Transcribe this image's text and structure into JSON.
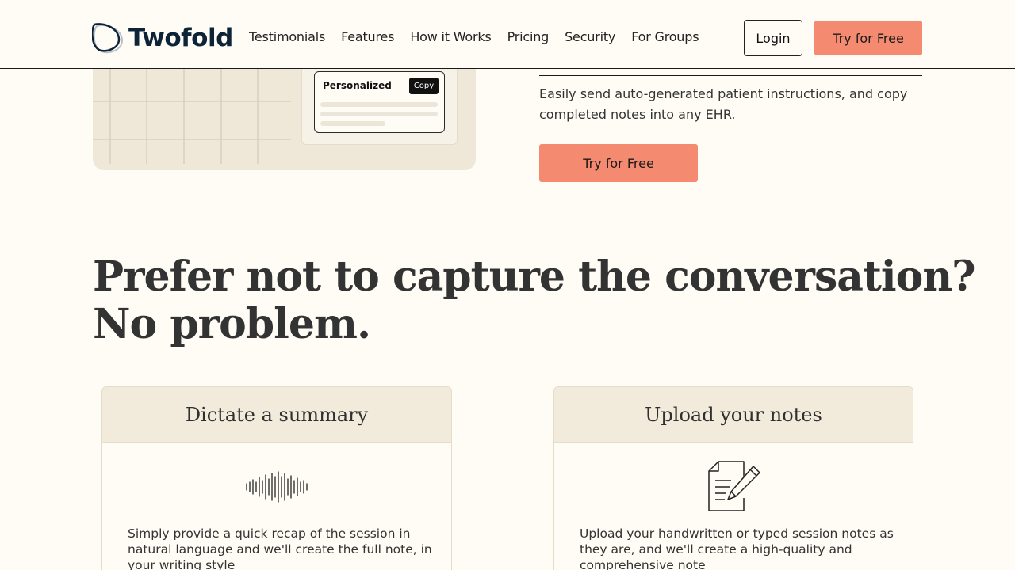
{
  "header": {
    "brand": "Twofold",
    "nav": [
      "Testimonials",
      "Features",
      "How it Works",
      "Pricing",
      "Security",
      "For Groups"
    ],
    "login_label": "Login",
    "try_label": "Try for Free"
  },
  "illustration": {
    "card_title": "Personalized",
    "copy_label": "Copy"
  },
  "feature": {
    "description": "Easily send auto-generated patient instructions, and copy completed notes into any EHR.",
    "cta_label": "Try for Free"
  },
  "headline": {
    "line1": "Prefer not to capture the conversation?",
    "line2": "No problem."
  },
  "options": [
    {
      "title": "Dictate a summary",
      "icon": "waveform-icon",
      "body": "Simply provide a quick recap of the session in natural language and we'll create the full note, in your writing style"
    },
    {
      "title": "Upload your notes",
      "icon": "document-pencil-icon",
      "body": "Upload your handwritten or typed session notes as they are, and we'll create a high-quality and comprehensive note"
    }
  ],
  "colors": {
    "accent": "#f48b70",
    "background": "#fefcf5",
    "brand_text": "#0d2438",
    "card_header": "#f2ebdc"
  }
}
